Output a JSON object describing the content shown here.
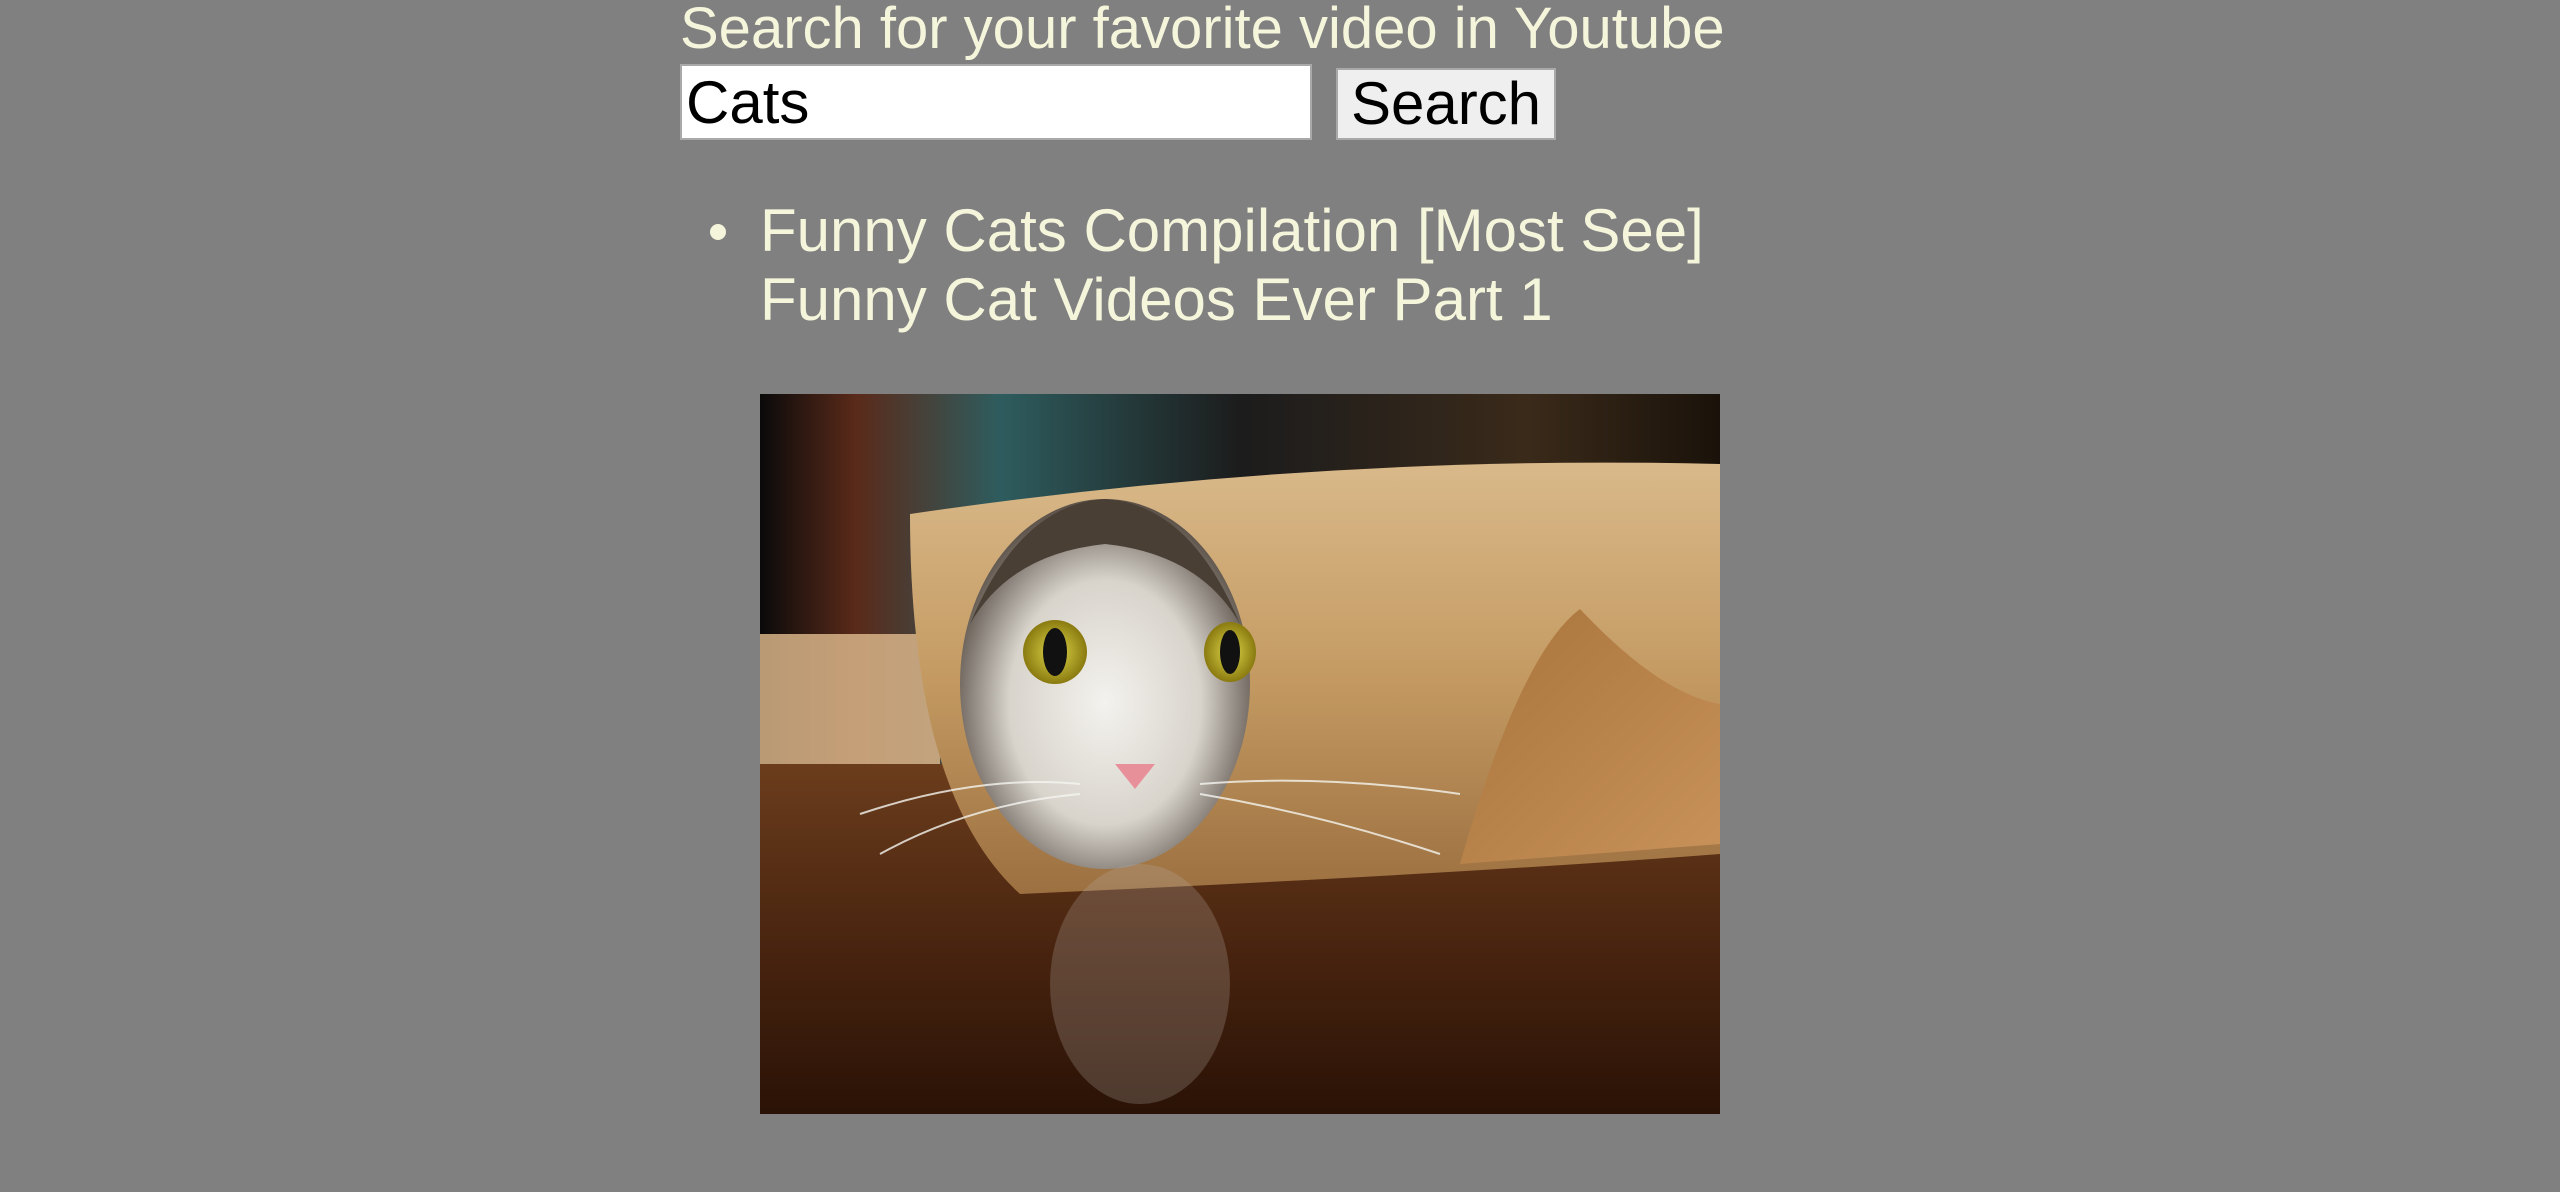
{
  "header": {
    "title": "Search for your favorite video in Youtube"
  },
  "search": {
    "value": "Cats",
    "button_label": "Search"
  },
  "results": [
    {
      "title": "Funny Cats Compilation [Most See] Funny Cat Videos Ever Part 1",
      "thumbnail_icon": "cat-in-paper-roll-thumbnail"
    }
  ],
  "colors": {
    "background": "#808080",
    "text": "#f5f5dc"
  }
}
